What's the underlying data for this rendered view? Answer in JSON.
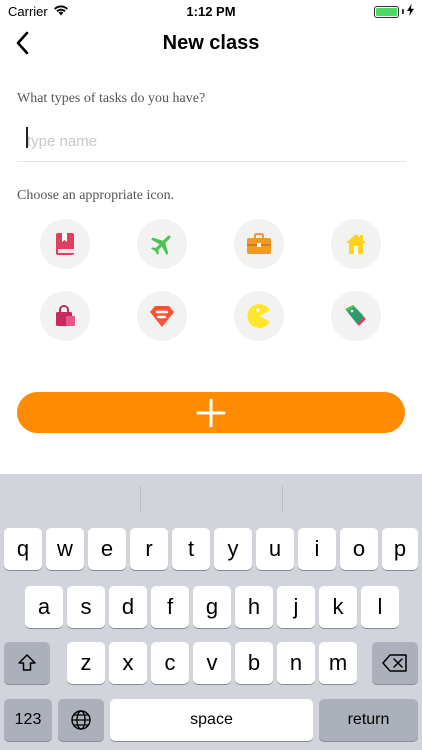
{
  "status_bar": {
    "carrier": "Carrier",
    "time": "1:12 PM"
  },
  "nav": {
    "title": "New class",
    "back_icon": "chevron-left-icon"
  },
  "form": {
    "question": "What types of tasks do you have?",
    "name_placeholder": "type name",
    "name_value": "",
    "icon_prompt": "Choose an appropriate icon."
  },
  "icons": [
    {
      "name": "book-icon",
      "color": "#e0405e"
    },
    {
      "name": "airplane-icon",
      "color": "#4cc550"
    },
    {
      "name": "briefcase-icon",
      "color": "#f39a26"
    },
    {
      "name": "house-icon",
      "color": "#ffd21f"
    },
    {
      "name": "shopping-bag-icon",
      "color": "#c62a5e"
    },
    {
      "name": "gem-icon",
      "color": "#ff5233"
    },
    {
      "name": "pacman-icon",
      "color": "#ffe62b"
    },
    {
      "name": "price-tags-icon",
      "color": "#2e9a72"
    }
  ],
  "add_button": {
    "icon": "plus-icon",
    "color": "#ff8c00"
  },
  "keyboard": {
    "row1": [
      "q",
      "w",
      "e",
      "r",
      "t",
      "y",
      "u",
      "i",
      "o",
      "p"
    ],
    "row2": [
      "a",
      "s",
      "d",
      "f",
      "g",
      "h",
      "j",
      "k",
      "l"
    ],
    "row3": [
      "z",
      "x",
      "c",
      "v",
      "b",
      "n",
      "m"
    ],
    "numbers_key": "123",
    "space_key": "space",
    "return_key": "return"
  }
}
